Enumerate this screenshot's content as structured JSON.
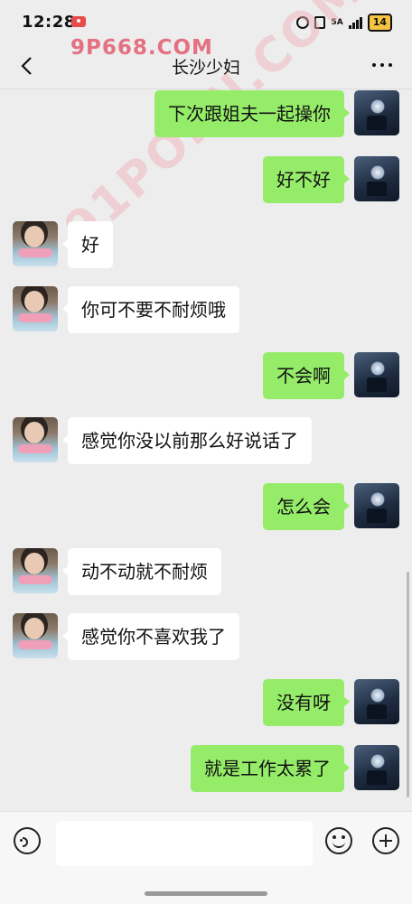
{
  "status_bar": {
    "time": "12:28",
    "network": "5A",
    "battery": "14"
  },
  "nav": {
    "title": "长沙少妇"
  },
  "watermark": {
    "top": "9P668.COM",
    "diagonal": "91PORN.COM"
  },
  "messages": [
    {
      "from": "me",
      "text": "下次跟姐夫一起操你"
    },
    {
      "from": "me",
      "text": "好不好"
    },
    {
      "from": "them",
      "text": "好"
    },
    {
      "from": "them",
      "text": "你可不要不耐烦哦"
    },
    {
      "from": "me",
      "text": "不会啊"
    },
    {
      "from": "them",
      "text": "感觉你没以前那么好说话了"
    },
    {
      "from": "me",
      "text": "怎么会"
    },
    {
      "from": "them",
      "text": "动不动就不耐烦"
    },
    {
      "from": "them",
      "text": "感觉你不喜欢我了"
    },
    {
      "from": "me",
      "text": "没有呀"
    },
    {
      "from": "me",
      "text": "就是工作太累了"
    }
  ],
  "input": {
    "value": ""
  },
  "icons": {
    "back": "chevron-left-icon",
    "more": "more-dots-icon",
    "voice": "voice-icon",
    "emoji": "emoji-icon",
    "add": "plus-icon"
  }
}
